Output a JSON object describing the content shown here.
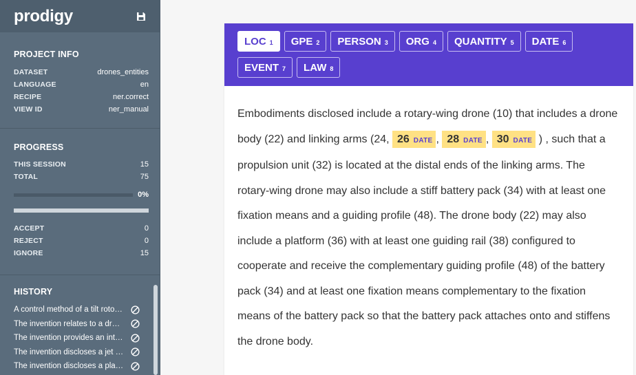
{
  "brand": {
    "name": "prodigy"
  },
  "project_info": {
    "title": "PROJECT INFO",
    "rows": [
      {
        "key": "DATASET",
        "value": "drones_entities"
      },
      {
        "key": "LANGUAGE",
        "value": "en"
      },
      {
        "key": "RECIPE",
        "value": "ner.correct"
      },
      {
        "key": "VIEW ID",
        "value": "ner_manual"
      }
    ]
  },
  "progress": {
    "title": "PROGRESS",
    "rows": [
      {
        "key": "THIS SESSION",
        "value": "15"
      },
      {
        "key": "TOTAL",
        "value": "75"
      }
    ],
    "percent_label": "0%",
    "percent": 0,
    "counts": [
      {
        "key": "ACCEPT",
        "value": "0"
      },
      {
        "key": "REJECT",
        "value": "0"
      },
      {
        "key": "IGNORE",
        "value": "15"
      }
    ]
  },
  "history": {
    "title": "HISTORY",
    "items": [
      "A control method of a tilt rotor aircraft",
      "The invention relates to a drone",
      "The invention provides an integrated",
      "The invention discloses a jet engine",
      "The invention discloses a platform"
    ]
  },
  "labels": [
    {
      "name": "LOC",
      "key": "1",
      "active": true
    },
    {
      "name": "GPE",
      "key": "2"
    },
    {
      "name": "PERSON",
      "key": "3"
    },
    {
      "name": "ORG",
      "key": "4"
    },
    {
      "name": "QUANTITY",
      "key": "5"
    },
    {
      "name": "DATE",
      "key": "6"
    },
    {
      "name": "EVENT",
      "key": "7"
    },
    {
      "name": "LAW",
      "key": "8"
    }
  ],
  "text": {
    "part1": "Embodiments disclosed include a rotary-wing drone (10) that includes a drone body (22) and linking arms (24, ",
    "entities": [
      {
        "text": "26",
        "label": "DATE"
      },
      {
        "text": "28",
        "label": "DATE"
      },
      {
        "text": "30",
        "label": "DATE"
      }
    ],
    "sep": ", ",
    "close": ")",
    "part2": ", such that a propulsion unit (32) is located at the distal ends of the linking arms. The rotary-wing drone may also include a stiff battery pack (34) with at least one fixation means and a guiding profile (48). The drone body (22) may also include a platform (36) with at least one guiding rail (38) configured to cooperate and receive the complementary guiding profile (48) of the battery pack (34) and at least one fixation means complementary to the fixation means of the battery pack so that the battery pack attaches onto and stiffens the drone body."
  },
  "colors": {
    "accent": "#583fcf",
    "entity_bg": "#ffe184",
    "sidebar": "#5a6c7c"
  }
}
